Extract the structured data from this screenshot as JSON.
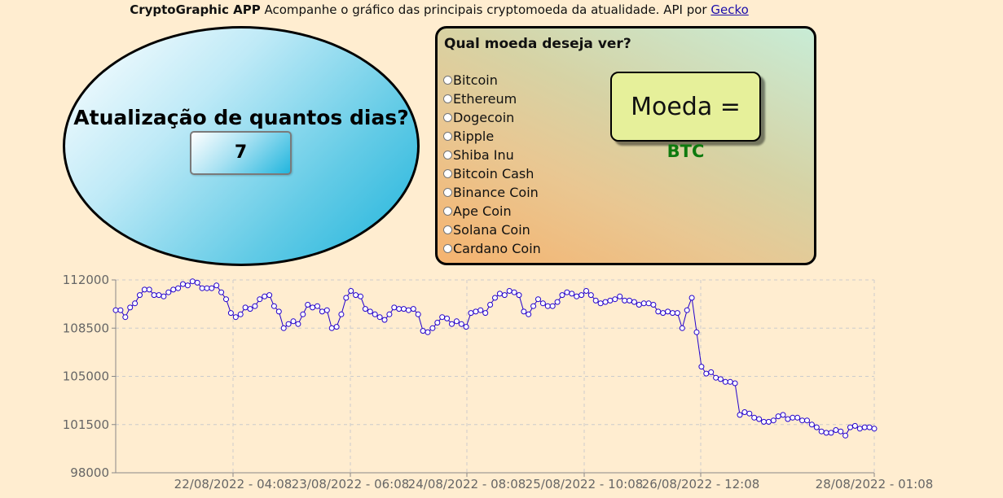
{
  "header": {
    "app_name": "CryptoGraphic APP",
    "description": " Acompanhe o gráfico das principais cryptomoeda da atualidade. API por ",
    "link_text": "Gecko"
  },
  "days_panel": {
    "question": "Atualização de quantos dias?",
    "value": "7"
  },
  "coin_panel": {
    "question": "Qual moeda deseja ver?",
    "options": [
      "Bitcoin",
      "Ethereum",
      "Dogecoin",
      "Ripple",
      "Shiba Inu",
      "Bitcoin Cash",
      "Binance Coin",
      "Ape Coin",
      "Solana Coin",
      "Cardano Coin"
    ],
    "selected_label": "Moeda = ",
    "selected_value": "BTC"
  },
  "colors": {
    "background": "#ffedd0",
    "line": "#2200cc",
    "moeda_value": "#0f7a0f"
  },
  "chart_data": {
    "type": "line",
    "x_ticks": [
      "22/08/2022 - 04:08",
      "23/08/2022 - 06:08",
      "24/08/2022 - 08:08",
      "25/08/2022 - 10:08",
      "26/08/2022 - 12:08",
      "28/08/2022 - 01:08"
    ],
    "y_ticks": [
      "112000",
      "108500",
      "105000",
      "101500",
      "98000"
    ],
    "ylim": [
      98000,
      112000
    ],
    "grid": true,
    "series": [
      {
        "values": [
          109800,
          109800,
          109300,
          110000,
          110300,
          110900,
          111300,
          111300,
          110900,
          110900,
          110800,
          111100,
          111300,
          111400,
          111700,
          111600,
          111900,
          111800,
          111400,
          111400,
          111400,
          111600,
          111100,
          110600,
          109600,
          109300,
          109500,
          110000,
          109900,
          110100,
          110600,
          110800,
          110900,
          110100,
          109700,
          108500,
          108800,
          109000,
          108800,
          109500,
          110200,
          110000,
          110100,
          109700,
          109800,
          108500,
          108600,
          109500,
          110700,
          111200,
          110900,
          110800,
          109900,
          109700,
          109500,
          109300,
          109100,
          109500,
          110000,
          109900,
          109900,
          109800,
          109900,
          109500,
          108300,
          108200,
          108500,
          108900,
          109300,
          109200,
          108800,
          109000,
          108800,
          108600,
          109600,
          109700,
          109800,
          109600,
          110200,
          110700,
          111000,
          110900,
          111200,
          111100,
          110900,
          109700,
          109500,
          110100,
          110600,
          110300,
          110100,
          110100,
          110400,
          110900,
          111100,
          111000,
          110800,
          110900,
          111200,
          110900,
          110500,
          110300,
          110400,
          110500,
          110600,
          110800,
          110500,
          110500,
          110400,
          110200,
          110300,
          110300,
          110200,
          109700,
          109600,
          109700,
          109600,
          109600,
          108500,
          109800,
          110700,
          108200,
          105700,
          105200,
          105300,
          104900,
          104800,
          104600,
          104600,
          104500,
          102200,
          102400,
          102300,
          102000,
          101900,
          101700,
          101700,
          101800,
          102100,
          102200,
          101900,
          102000,
          102000,
          101800,
          101800,
          101500,
          101300,
          101000,
          100900,
          100900,
          101100,
          101000,
          100700,
          101300,
          101400,
          101200,
          101300,
          101300,
          101200
        ]
      }
    ]
  }
}
